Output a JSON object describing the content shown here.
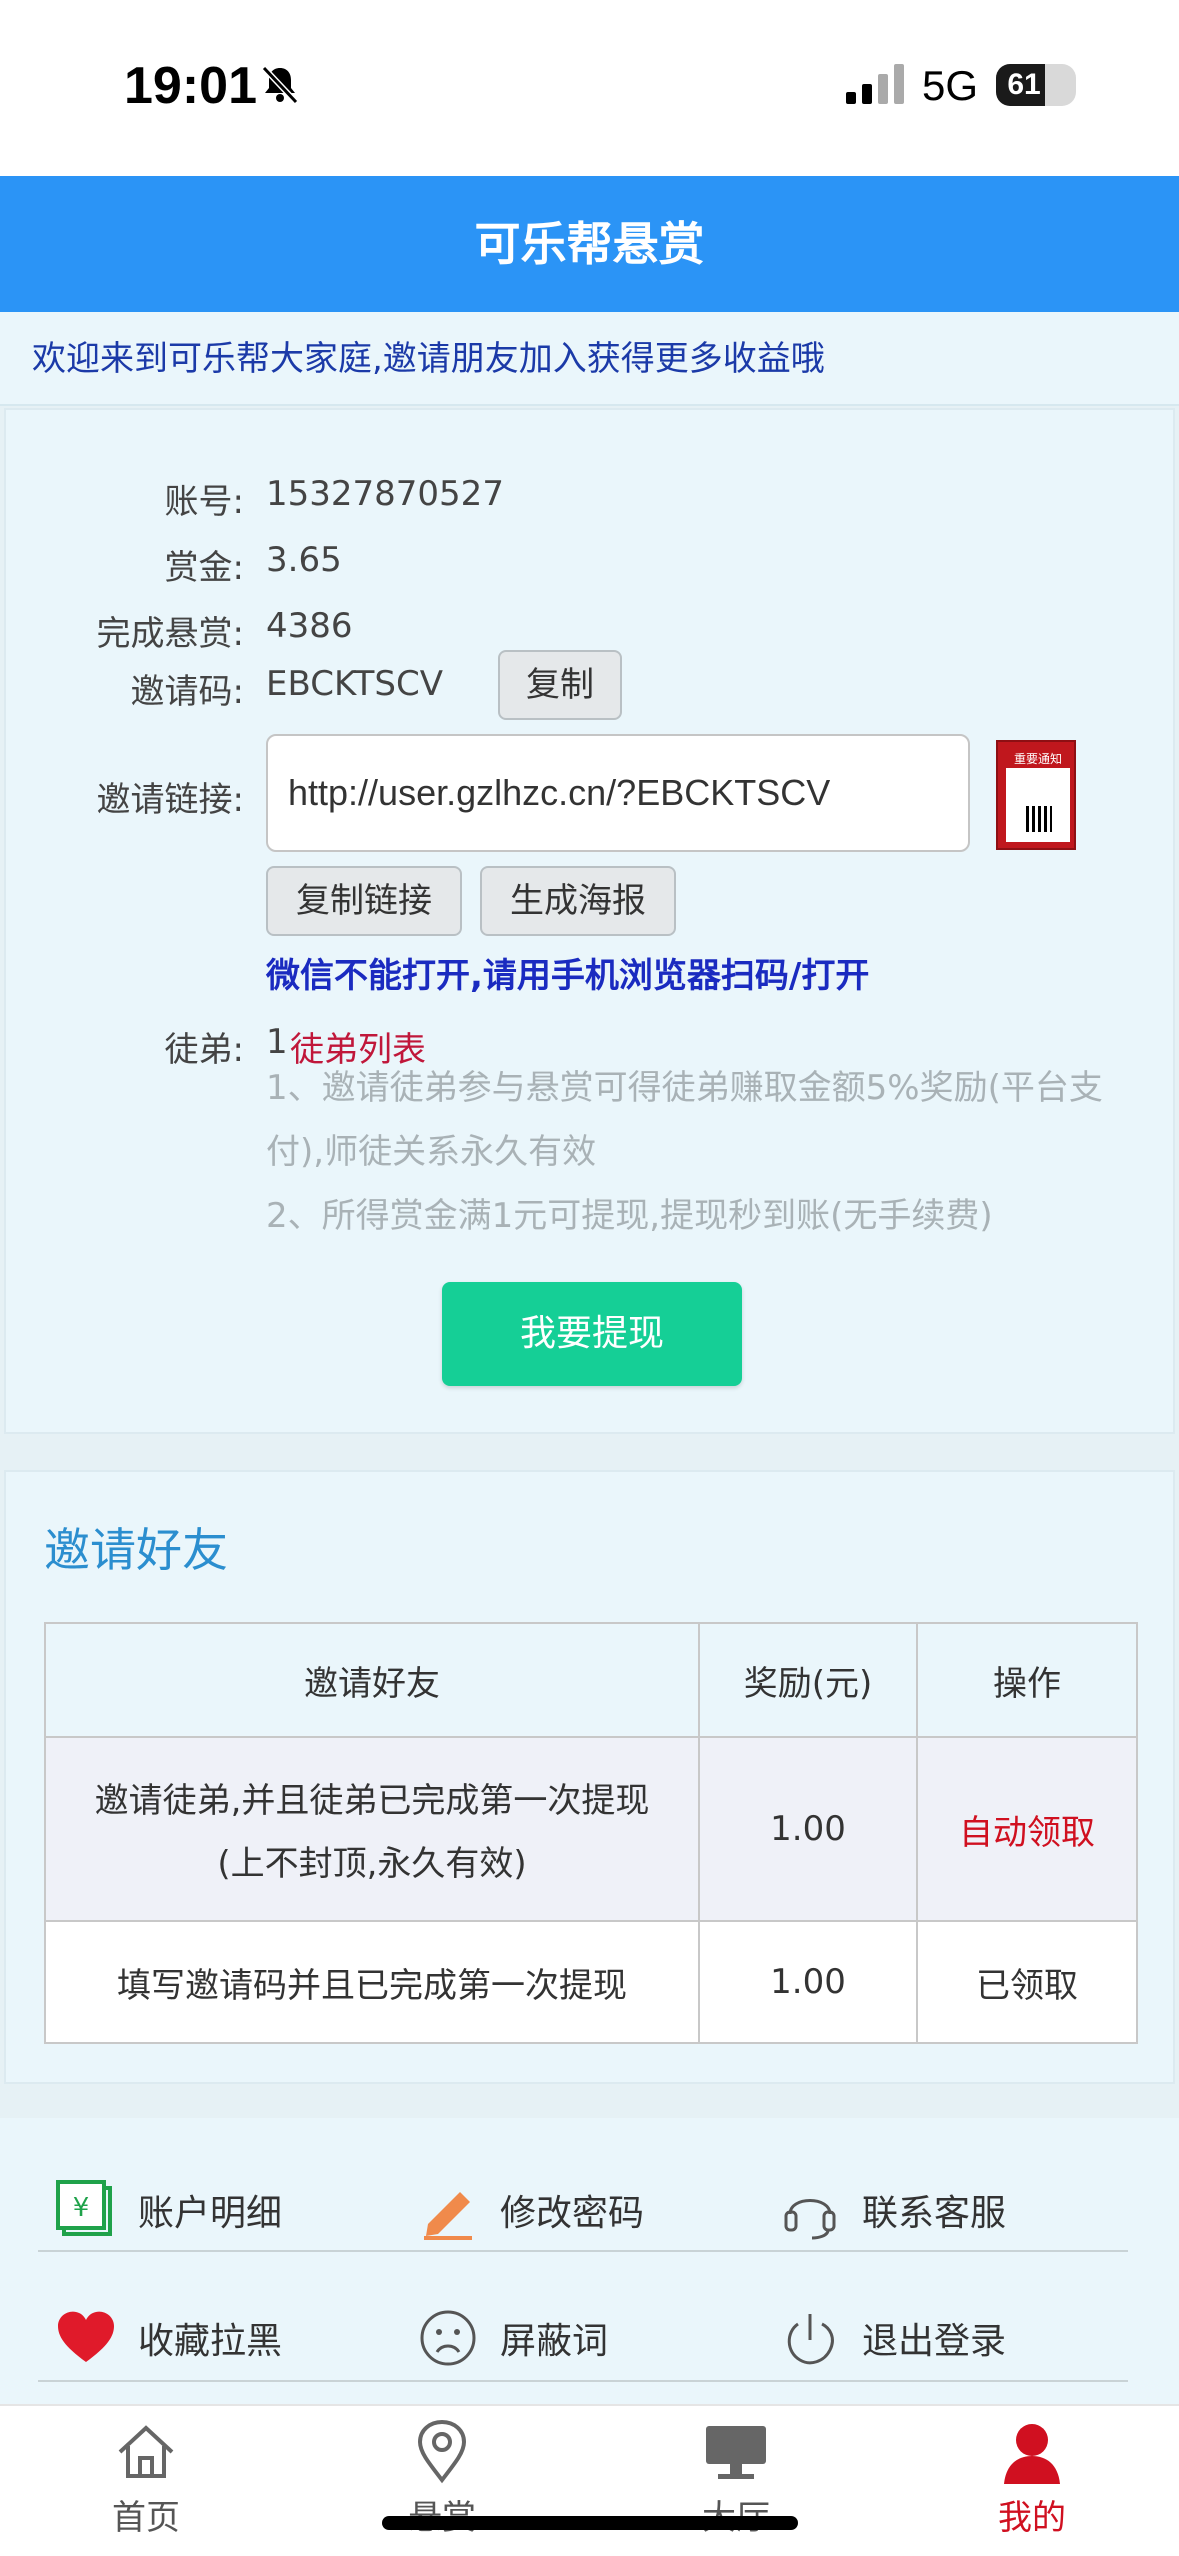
{
  "status_bar": {
    "time": "19:01",
    "network": "5G",
    "battery": "61",
    "battery_level": 0.61
  },
  "header": {
    "title": "可乐帮悬赏"
  },
  "welcome": {
    "text": "欢迎来到可乐帮大家庭,邀请朋友加入获得更多收益哦"
  },
  "account": {
    "account_label": "账号:",
    "account_value": "15327870527",
    "bounty_label": "赏金:",
    "bounty_value": "3.65",
    "completed_label": "完成悬赏:",
    "completed_value": "4386",
    "invite_code_label": "邀请码:",
    "invite_code_value": "EBCKTSCV",
    "copy_button": "复制",
    "invite_link_label": "邀请链接:",
    "invite_link_value": "http://user.gzlhzc.cn/?EBCKTSCV",
    "poster_thumb_text": "重要通知",
    "copy_link_button": "复制链接",
    "generate_poster_button": "生成海报",
    "wechat_notice": "微信不能打开,请用手机浏览器扫码/打开",
    "apprentice_label": "徒弟:",
    "apprentice_count": "1",
    "apprentice_list_link": "徒弟列表",
    "rule_1_line1": "1、邀请徒弟参与悬赏可得徒弟赚取金额5%奖励(平台支",
    "rule_1_line2": "付),师徒关系永久有效",
    "rule_2": "2、所得赏金满1元可提现,提现秒到账(无手续费)",
    "withdraw_button": "我要提现"
  },
  "invite_section": {
    "title": "邀请好友",
    "columns": [
      "邀请好友",
      "奖励(元)",
      "操作"
    ],
    "rows": [
      {
        "desc_line1": "邀请徒弟,并且徒弟已完成第一次提现",
        "desc_line2": "(上不封顶,永久有效)",
        "reward": "1.00",
        "action": "自动领取"
      },
      {
        "desc_line1": "填写邀请码并且已完成第一次提现",
        "reward": "1.00",
        "action": "已领取"
      }
    ]
  },
  "menu": {
    "items": [
      {
        "label": "账户明细",
        "icon": "money-icon"
      },
      {
        "label": "修改密码",
        "icon": "pencil-icon"
      },
      {
        "label": "联系客服",
        "icon": "headset-icon"
      },
      {
        "label": "收藏拉黑",
        "icon": "heart-icon"
      },
      {
        "label": "屏蔽词",
        "icon": "sad-face-icon"
      },
      {
        "label": "退出登录",
        "icon": "power-icon"
      }
    ]
  },
  "tab_bar": {
    "tabs": [
      {
        "label": "首页",
        "icon": "home-icon"
      },
      {
        "label": "悬赏",
        "icon": "location-pin-icon"
      },
      {
        "label": "大厅",
        "icon": "monitor-icon"
      },
      {
        "label": "我的",
        "icon": "user-icon"
      }
    ],
    "active": "我的"
  },
  "colors": {
    "header": "#2b94f6",
    "withdraw": "#15cf96",
    "accent_red": "#d01020",
    "notice_blue": "#1a2bc0"
  }
}
